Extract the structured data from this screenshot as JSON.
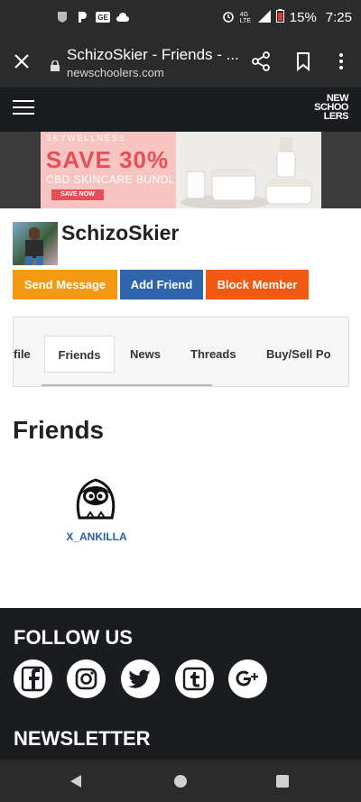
{
  "status_bar": {
    "battery": "15%",
    "time": "7:25",
    "network": "4G LTE",
    "icons": [
      "nfl-icon",
      "pandora-icon",
      "ge-icon",
      "cloud-icon",
      "alarm-icon",
      "signal-icon",
      "battery-icon"
    ]
  },
  "browser": {
    "tab_title": "SchizoSkier - Friends - ...",
    "url": "newschoolers.com"
  },
  "site": {
    "logo_lines": [
      "NEW",
      "SCHOO",
      "LERS"
    ]
  },
  "ad": {
    "brand": "SKYWELLNESS",
    "headline": "SAVE 30%",
    "subline": "CBD SKINCARE BUNDLE",
    "cta": "SAVE NOW"
  },
  "profile": {
    "username": "SchizoSkier",
    "buttons": {
      "send_message": "Send Message",
      "add_friend": "Add Friend",
      "block_member": "Block Member"
    },
    "colors": {
      "send_message": "#f39a12",
      "add_friend": "#2f65ad",
      "block_member": "#f25a13"
    }
  },
  "tabs": {
    "items": [
      {
        "label": "file"
      },
      {
        "label": "Friends"
      },
      {
        "label": "News"
      },
      {
        "label": "Threads"
      },
      {
        "label": "Buy/Sell Po"
      }
    ],
    "active": "Friends"
  },
  "friends_section": {
    "title": "Friends",
    "friends": [
      {
        "name": "X_ANKILLA"
      }
    ]
  },
  "footer": {
    "follow_title": "FOLLOW US",
    "newsletter_title": "NEWSLETTER",
    "social": [
      "facebook-icon",
      "instagram-icon",
      "twitter-icon",
      "tumblr-icon",
      "google-plus-icon"
    ]
  }
}
